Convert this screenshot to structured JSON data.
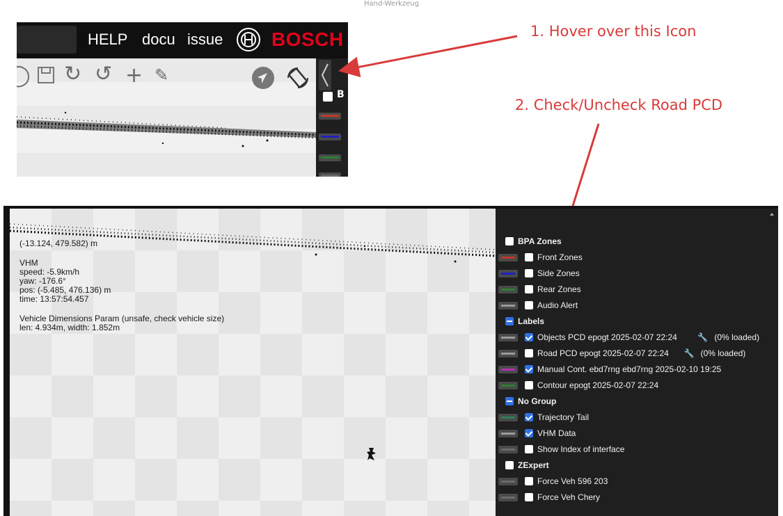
{
  "caption_top": "Hand-Werkzeug",
  "top_screenshot": {
    "header_links": [
      "HELP",
      "docu",
      "issue"
    ],
    "brand": "BOSCH",
    "side_letter": "B",
    "legend_colors": [
      "#c0392b",
      "#2020c0",
      "#2e7d32",
      "#6a6a6a"
    ]
  },
  "annotations": {
    "step1": "1. Hover over this Icon",
    "step2": "2. Check/Uncheck Road PCD",
    "color": "#d93a3a"
  },
  "canvas_info": {
    "pos_top": "(-13.124, 479.582) m",
    "vhm_title": "VHM",
    "speed": "speed: -5.9km/h",
    "yaw": "yaw: -176.6°",
    "pos": "pos: (-5.485, 476.136) m",
    "time": "time: 13:57:54.457",
    "dims_title": "Vehicle Dimensions Param (unsafe, check vehicle size)",
    "dims_values": "len: 4.934m, width: 1.852m"
  },
  "layers": [
    {
      "type": "group",
      "label": "BPA Zones",
      "state": "unchecked"
    },
    {
      "type": "item",
      "label": "Front Zones",
      "state": "unchecked",
      "color": "#c0392b"
    },
    {
      "type": "item",
      "label": "Side Zones",
      "state": "unchecked",
      "color": "#2020c0"
    },
    {
      "type": "item",
      "label": "Rear Zones",
      "state": "unchecked",
      "color": "#2e7d32"
    },
    {
      "type": "item",
      "label": "Audio Alert",
      "state": "unchecked",
      "color": "#9a9a9a"
    },
    {
      "type": "group",
      "label": "Labels",
      "state": "partial"
    },
    {
      "type": "item",
      "label": "Objects PCD epogt 2025-02-07 22:24",
      "state": "checked",
      "color": "#9a9a9a",
      "wrench": true,
      "suffix": "(0% loaded)"
    },
    {
      "type": "item",
      "label": "Road PCD epogt 2025-02-07 22:24",
      "state": "unchecked",
      "color": "#9a9a9a",
      "wrench": true,
      "suffix": "(0% loaded)"
    },
    {
      "type": "item",
      "label": "Manual Cont. ebd7rng ebd7rng 2025-02-10 19:25",
      "state": "checked",
      "color": "#b030b0"
    },
    {
      "type": "item",
      "label": "Contour epogt 2025-02-07 22:24",
      "state": "unchecked",
      "color": "#2e7d32"
    },
    {
      "type": "group",
      "label": "No Group",
      "state": "partial"
    },
    {
      "type": "item",
      "label": "Trajectory Tail",
      "state": "checked",
      "color": "#2e7d5a"
    },
    {
      "type": "item",
      "label": "VHM Data",
      "state": "checked",
      "color": "#9a9a9a"
    },
    {
      "type": "item",
      "label": "Show Index of interface",
      "state": "unchecked",
      "color": "#6a6a6a"
    },
    {
      "type": "group",
      "label": "ZExpert",
      "state": "unchecked"
    },
    {
      "type": "item",
      "label": "Force Veh 596 203",
      "state": "unchecked",
      "color": "#6a6a6a"
    },
    {
      "type": "item",
      "label": "Force Veh Chery",
      "state": "unchecked",
      "color": "#6a6a6a"
    }
  ]
}
